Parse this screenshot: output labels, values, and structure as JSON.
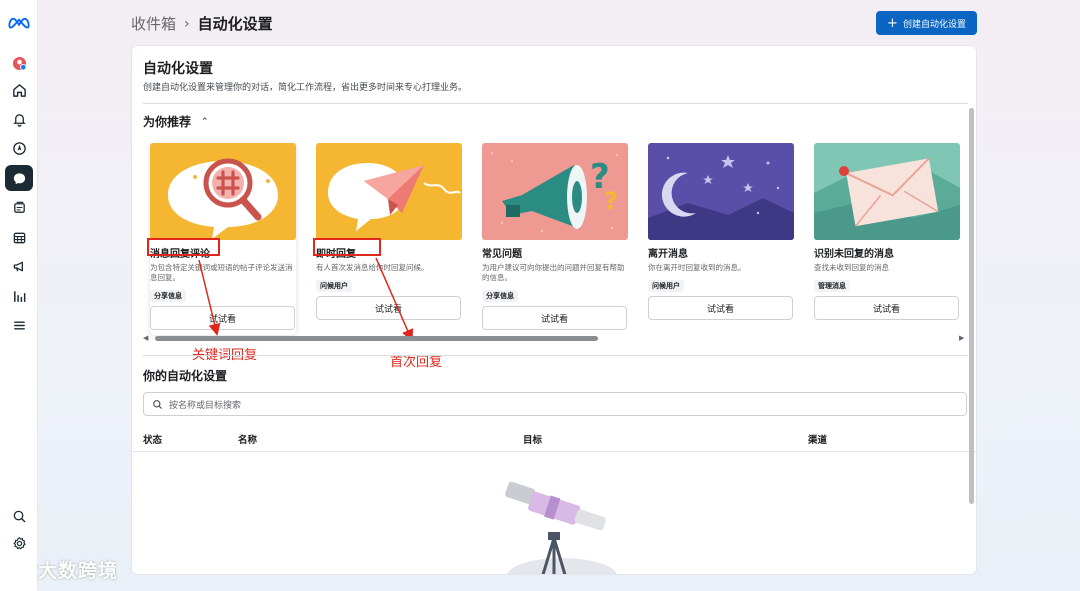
{
  "breadcrumb": {
    "parent": "收件箱",
    "separator": "›",
    "current": "自动化设置"
  },
  "create_button": {
    "label": "创建自动化设置",
    "color": "#0a66c2"
  },
  "card": {
    "title": "自动化设置",
    "description": "创建自动化设置来管理你的对话，简化工作流程，省出更多时间来专心打理业务。"
  },
  "recommended": {
    "title": "为你推荐",
    "toggle_icon": "chevron-up-icon",
    "tiles": [
      {
        "name": "消息回复评论",
        "desc": "为包含特定关键词或短语的帖子评论发送消息回复。",
        "tag": "分享信息",
        "button": "试试看",
        "image": "hashtag-magnifier-illustration"
      },
      {
        "name": "即时回复",
        "desc": "有人首次发消息给你时回复问候。",
        "tag": "问候用户",
        "button": "试试看",
        "image": "paper-plane-illustration"
      },
      {
        "name": "常见问题",
        "desc": "为用户建议可向你提出的问题并回复有帮助的信息。",
        "tag": "分享信息",
        "button": "试试看",
        "image": "megaphone-question-illustration"
      },
      {
        "name": "离开消息",
        "desc": "你在离开时回复收到的消息。",
        "tag": "问候用户",
        "button": "试试看",
        "image": "moon-stars-illustration"
      },
      {
        "name": "识别未回复的消息",
        "desc": "查找未收到回复的消息",
        "tag": "管理消息",
        "button": "试试看",
        "image": "envelope-illustration"
      }
    ]
  },
  "annotations": {
    "first": "关键词回复",
    "second": "首次回复",
    "color": "#e0271b"
  },
  "automations": {
    "title": "你的自动化设置",
    "search_placeholder": "按名称或目标搜索",
    "columns": [
      "状态",
      "名称",
      "目标",
      "渠道"
    ]
  },
  "sidebar": {
    "icons": [
      "meta-logo-icon",
      "profile-avatar-icon",
      "home-icon",
      "bell-icon",
      "compass-icon",
      "inbox-chat-icon",
      "content-icon",
      "calendar-icon",
      "megaphone-icon",
      "insights-icon",
      "menu-icon",
      "search-icon",
      "settings-icon"
    ]
  },
  "watermark": "大数跨境"
}
